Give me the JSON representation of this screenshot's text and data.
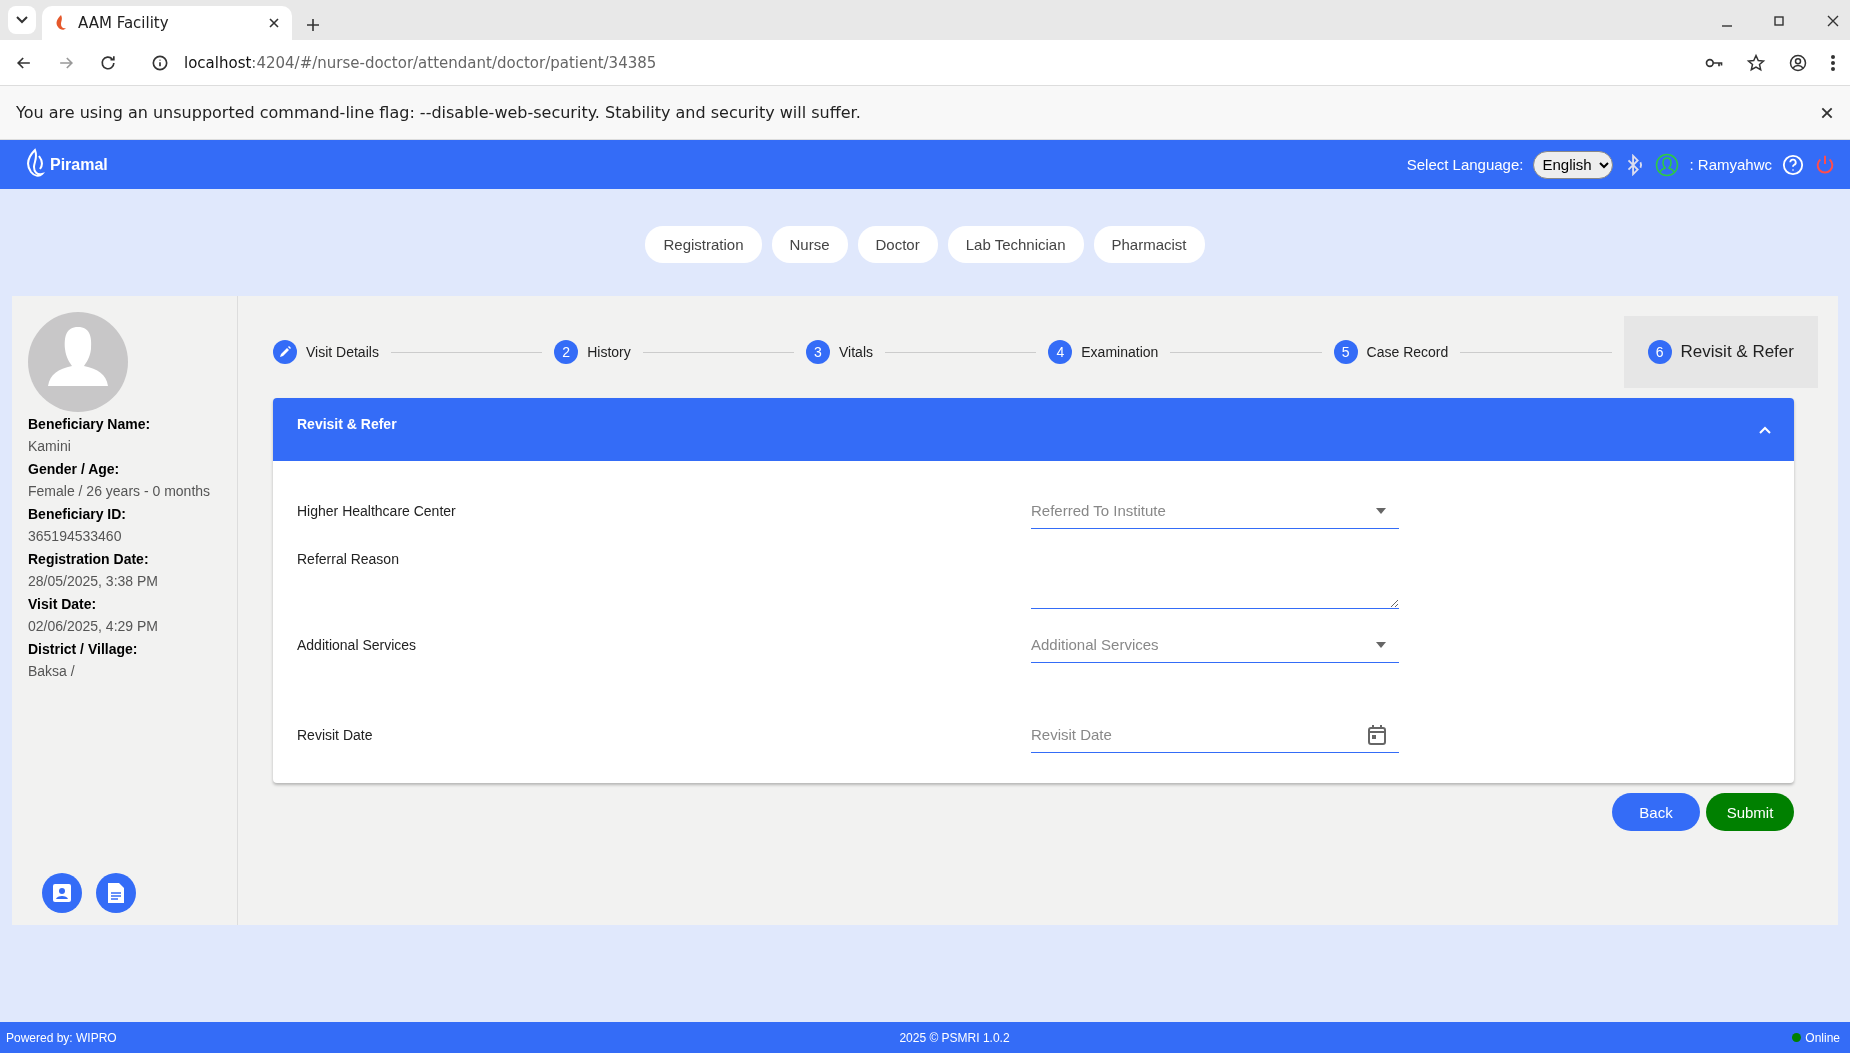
{
  "browser": {
    "tabs": [
      {
        "title": "AAM Facility",
        "selected": true
      }
    ],
    "url": {
      "host": "localhost",
      "path": ":4204/#/nurse-doctor/attendant/doctor/patient/34385"
    },
    "infobar": {
      "message": "You are using an unsupported command-line flag: --disable-web-security. Stability and security will suffer."
    }
  },
  "header": {
    "brand": "Piramal",
    "language_label": "Select Language:",
    "language": "English",
    "user": ": Ramyahwc"
  },
  "roles": [
    {
      "label": "Registration"
    },
    {
      "label": "Nurse"
    },
    {
      "label": "Doctor"
    },
    {
      "label": "Lab Technician"
    },
    {
      "label": "Pharmacist"
    }
  ],
  "beneficiary": [
    {
      "label": "Beneficiary Name:",
      "value": "Kamini"
    },
    {
      "label": "Gender / Age:",
      "value": "Female / 26 years - 0 months"
    },
    {
      "label": "Beneficiary ID:",
      "value": "365194533460"
    },
    {
      "label": "Registration Date:",
      "value": "28/05/2025, 3:38 PM"
    },
    {
      "label": "Visit Date:",
      "value": "02/06/2025, 4:29 PM"
    },
    {
      "label": "District / Village:",
      "value": "Baksa /"
    }
  ],
  "steps": [
    {
      "kind": "edit",
      "label": "Visit Details",
      "selected": false
    },
    {
      "kind": "number",
      "number": "2",
      "label": "History",
      "selected": false
    },
    {
      "kind": "number",
      "number": "3",
      "label": "Vitals",
      "selected": false
    },
    {
      "kind": "number",
      "number": "4",
      "label": "Examination",
      "selected": false
    },
    {
      "kind": "number",
      "number": "5",
      "label": "Case Record",
      "selected": false
    },
    {
      "kind": "number",
      "number": "6",
      "label": "Revisit & Refer",
      "selected": true
    }
  ],
  "section": {
    "title": "Revisit & Refer",
    "expanded": true
  },
  "fields": [
    {
      "label": "Higher Healthcare Center",
      "kind": "select",
      "placeholder": "Referred To Institute"
    },
    {
      "label": "Referral Reason",
      "kind": "textarea"
    },
    {
      "label": "Additional Services",
      "kind": "select",
      "placeholder": "Additional Services"
    },
    {
      "label": "Revisit Date",
      "kind": "date",
      "placeholder": "Revisit Date"
    }
  ],
  "buttons": [
    {
      "label": "Back",
      "kind": "primary"
    },
    {
      "label": "Submit",
      "kind": "success"
    }
  ],
  "footer": {
    "powered": "Powered by: WIPRO",
    "copyright": "2025 © PSMRI 1.0.2",
    "status": {
      "label": "Online",
      "color": "#008000"
    }
  }
}
